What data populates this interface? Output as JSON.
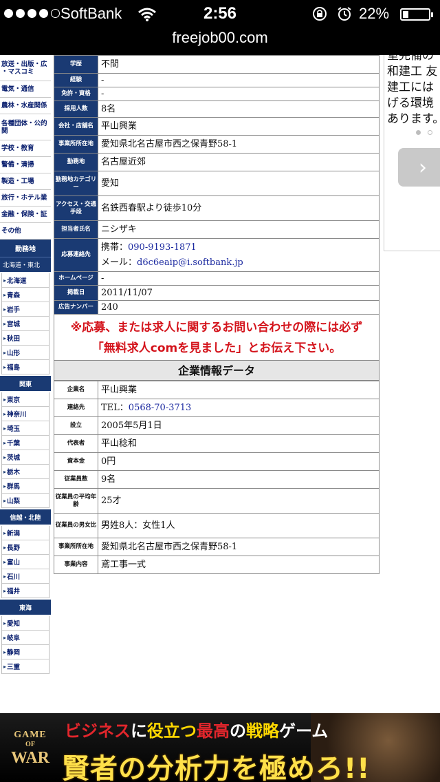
{
  "status_bar": {
    "carrier": "SoftBank",
    "time": "2:56",
    "battery_percent": "22%",
    "battery_level": 0.22
  },
  "browser": {
    "url": "freejob00.com"
  },
  "sidebar": {
    "categories": [
      "放送・出版・広\n・マスコミ",
      "電気・通信",
      "農林・水産関係",
      "各種団体・公的\n関",
      "学校・教育",
      "警備・清掃",
      "製造・工場",
      "旅行・ホテル業",
      "金融・保険・証",
      "その他"
    ],
    "work_location_heading": "勤務地",
    "regions": [
      {
        "name": "北海道・東北",
        "prefs": [
          "北海道",
          "青森",
          "岩手",
          "宮城",
          "秋田",
          "山形",
          "福島"
        ]
      },
      {
        "name": "関東",
        "prefs": [
          "東京",
          "神奈川",
          "埼玉",
          "千葉",
          "茨城",
          "栃木",
          "群馬",
          "山梨"
        ]
      },
      {
        "name": "信越・北陸",
        "prefs": [
          "新潟",
          "長野",
          "富山",
          "石川",
          "福井"
        ]
      },
      {
        "name": "東海",
        "prefs": [
          "愛知",
          "岐阜",
          "静岡",
          "三重"
        ]
      }
    ]
  },
  "job_table": [
    {
      "label": "学歴",
      "value": "不問"
    },
    {
      "label": "経験",
      "value": "-"
    },
    {
      "label": "免許・資格",
      "value": "-"
    },
    {
      "label": "採用人数",
      "value": "8名"
    },
    {
      "label": "会社・店舗名",
      "value": "平山興業"
    },
    {
      "label": "事業所所在地",
      "value": "愛知県北名古屋市西之保青野58-1"
    },
    {
      "label": "勤務地",
      "value": "名古屋近郊"
    },
    {
      "label": "勤務地カテゴリー",
      "value": "愛知"
    },
    {
      "label": "アクセス・交通手段",
      "value": "名鉄西春駅より徒歩10分"
    },
    {
      "label": "担当者氏名",
      "value": "ニシザキ"
    },
    {
      "label": "応募連絡先",
      "phone_prefix": "携帯：",
      "phone": "090-9193-1871",
      "mail_prefix": "メール：",
      "mail": "d6c6eaip@i.softbank.jp"
    },
    {
      "label": "ホームページ",
      "value": "-"
    },
    {
      "label": "掲載日",
      "value": "2011/11/07"
    },
    {
      "label": "広告ナンバー",
      "value": "240"
    }
  ],
  "notice": {
    "mark": "※",
    "line1": "応募、または求人に関するお問い合わせの際には必ず",
    "line2": "「無料求人comを見ました」とお伝え下さい。"
  },
  "company": {
    "title": "企業情報データ",
    "rows": [
      {
        "label": "企業名",
        "value": "平山興業"
      },
      {
        "label": "連絡先",
        "prefix": "TEL：",
        "value": "0568-70-3713"
      },
      {
        "label": "設立",
        "value": "2005年5月1日"
      },
      {
        "label": "代表者",
        "value": "平山稔和"
      },
      {
        "label": "資本金",
        "value": "0円"
      },
      {
        "label": "従業員数",
        "value": "9名"
      },
      {
        "label": "従業員の平均年齢",
        "value": "25才"
      },
      {
        "label": "従業員の男女比",
        "value": "男姓8人：女性1人"
      },
      {
        "label": "事業所所在地",
        "value": "愛知県北名古屋市西之保青野58-1"
      },
      {
        "label": "事業内容",
        "value": "鳶工事一式"
      }
    ]
  },
  "right_panel": {
    "lines": [
      "室完備の",
      "和建工 友",
      "建工には",
      "げる環境",
      "あります。"
    ],
    "next_button": "›"
  },
  "banner": {
    "logo_line1": "GAME",
    "logo_line2": "OF",
    "logo_line3": "WAR",
    "top_a": "ビジネス",
    "top_b": "に",
    "top_c": "役立つ",
    "top_d": "最高",
    "top_e": "の",
    "top_f": "戦略",
    "top_g": "ゲーム",
    "bottom": "賢者の分析力を極めろ!!"
  }
}
